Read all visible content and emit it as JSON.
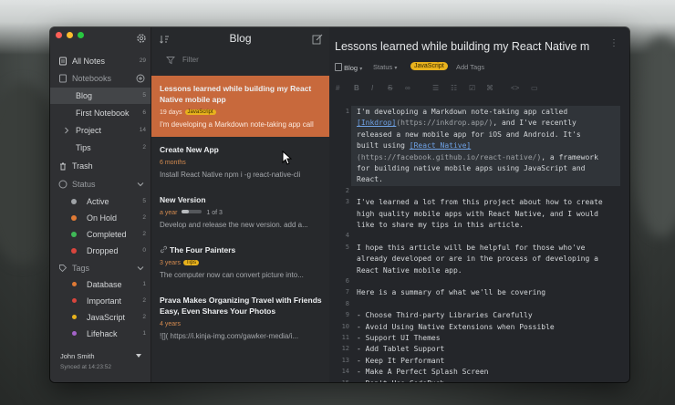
{
  "sidebar": {
    "items": [
      {
        "label": "All Notes",
        "count": "29"
      },
      {
        "label": "Notebooks",
        "count": ""
      },
      {
        "label": "Blog",
        "count": "5"
      },
      {
        "label": "First Notebook",
        "count": "6"
      },
      {
        "label": "Project",
        "count": "14"
      },
      {
        "label": "Tips",
        "count": "2"
      },
      {
        "label": "Trash",
        "count": ""
      },
      {
        "label": "Status",
        "count": ""
      },
      {
        "label": "Active",
        "count": "5"
      },
      {
        "label": "On Hold",
        "count": "2"
      },
      {
        "label": "Completed",
        "count": "2"
      },
      {
        "label": "Dropped",
        "count": "0"
      },
      {
        "label": "Tags",
        "count": ""
      },
      {
        "label": "Database",
        "count": "1"
      },
      {
        "label": "Important",
        "count": "2"
      },
      {
        "label": "JavaScript",
        "count": "2"
      },
      {
        "label": "Lifehack",
        "count": "1"
      }
    ],
    "user_name": "John Smith",
    "synced": "Synced at 14:23:52"
  },
  "note_list": {
    "title": "Blog",
    "filter_placeholder": "Filter",
    "notes": [
      {
        "title": "Lessons learned while building my React Native mobile app",
        "meta": "19 days",
        "tag": "JavaScript",
        "preview": "I'm developing a Markdown note-taking app call"
      },
      {
        "title": "Create New App",
        "meta": "6 months",
        "tag": "",
        "preview": "Install React Native npm i -g react-native-cli"
      },
      {
        "title": "New Version",
        "meta": "a year",
        "tag": "",
        "progress": "1 of 3",
        "preview": "Develop and release the new version. add a..."
      },
      {
        "title": "The Four Painters",
        "meta": "3 years",
        "tag": "Tips",
        "preview": "The computer now can convert picture into..."
      },
      {
        "title": "Prava Makes Organizing Travel with Friends Easy, Even Shares Your Photos",
        "meta": "4 years",
        "tag": "",
        "preview": "![]( https://i.kinja-img.com/gawker-media/i..."
      }
    ]
  },
  "editor": {
    "title": "Lessons learned while building my React Native m",
    "notebook": "Blog",
    "status": "Status",
    "tag": "JavaScript",
    "add_tags": "Add Tags",
    "lines": [
      {
        "n": "1",
        "t": "I'm developing a Markdown note-taking app called"
      },
      {
        "n": "",
        "t": "[Inkdrop](https://inkdrop.app/), and I've recently"
      },
      {
        "n": "",
        "t": "released a new mobile app for iOS and Android. It's"
      },
      {
        "n": "",
        "t": "built using [React Native]"
      },
      {
        "n": "",
        "t": "(https://facebook.github.io/react-native/), a framework"
      },
      {
        "n": "",
        "t": "for building native mobile apps using JavaScript and"
      },
      {
        "n": "",
        "t": "React."
      },
      {
        "n": "2",
        "t": ""
      },
      {
        "n": "3",
        "t": "I've learned a lot from this project about how to create"
      },
      {
        "n": "",
        "t": "high quality mobile apps with React Native, and I would"
      },
      {
        "n": "",
        "t": "like to share my tips in this article."
      },
      {
        "n": "4",
        "t": ""
      },
      {
        "n": "5",
        "t": "I hope this article will be helpful for those who've"
      },
      {
        "n": "",
        "t": "already developed or are in the process of developing a"
      },
      {
        "n": "",
        "t": "React Native mobile app."
      },
      {
        "n": "6",
        "t": ""
      },
      {
        "n": "7",
        "t": "Here is a summary of what we'll be covering"
      },
      {
        "n": "8",
        "t": ""
      },
      {
        "n": "9",
        "t": "- Choose Third-party Libraries Carefully"
      },
      {
        "n": "10",
        "t": "- Avoid Using Native Extensions when Possible"
      },
      {
        "n": "11",
        "t": "- Support UI Themes"
      },
      {
        "n": "12",
        "t": "- Add Tablet Support"
      },
      {
        "n": "13",
        "t": "- Keep It Performant"
      },
      {
        "n": "14",
        "t": "- Make A Perfect Splash Screen"
      },
      {
        "n": "15",
        "t": "- Don't Use CodePush"
      }
    ]
  },
  "colors": {
    "accent": "#c8693c",
    "tag": "#e8b21d",
    "link": "#6fa2e6"
  }
}
